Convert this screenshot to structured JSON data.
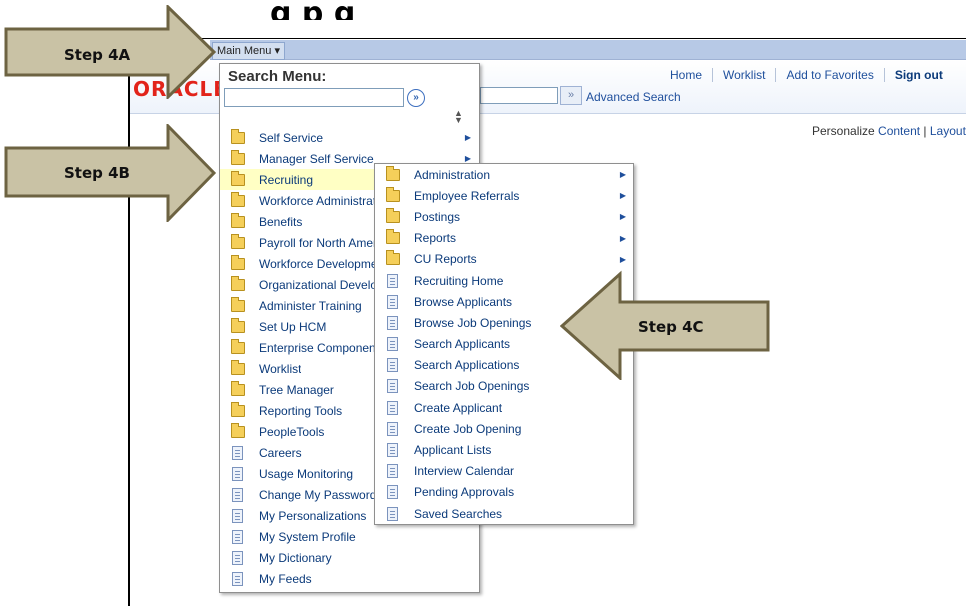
{
  "title_partial": "g                                          p  g",
  "header": {
    "main_menu_label": "Main Menu ▾",
    "logo_text": "ORACLE",
    "nav": [
      "Home",
      "Worklist",
      "Add to Favorites",
      "Sign out"
    ],
    "search_go": "»",
    "advanced_search": "Advanced Search",
    "personalize_prefix": "Personalize ",
    "personalize_content": "Content",
    "personalize_sep": " | ",
    "personalize_layout": "Layout"
  },
  "menu": {
    "search_label": "Search Menu:",
    "search_value": "",
    "search_go": "»",
    "items": [
      {
        "label": "Self Service",
        "type": "folder",
        "arrow": true
      },
      {
        "label": "Manager Self Service",
        "type": "folder",
        "arrow": true
      },
      {
        "label": "Recruiting",
        "type": "folder",
        "arrow": false,
        "highlight": true
      },
      {
        "label": "Workforce Administration",
        "type": "folder",
        "arrow": false
      },
      {
        "label": "Benefits",
        "type": "folder",
        "arrow": false
      },
      {
        "label": "Payroll for North America",
        "type": "folder",
        "arrow": false
      },
      {
        "label": "Workforce Development",
        "type": "folder",
        "arrow": false
      },
      {
        "label": "Organizational Development",
        "type": "folder",
        "arrow": false
      },
      {
        "label": "Administer Training",
        "type": "folder",
        "arrow": false
      },
      {
        "label": "Set Up HCM",
        "type": "folder",
        "arrow": false
      },
      {
        "label": "Enterprise Components",
        "type": "folder",
        "arrow": false
      },
      {
        "label": "Worklist",
        "type": "folder",
        "arrow": false
      },
      {
        "label": "Tree Manager",
        "type": "folder",
        "arrow": false
      },
      {
        "label": "Reporting Tools",
        "type": "folder",
        "arrow": false
      },
      {
        "label": "PeopleTools",
        "type": "folder",
        "arrow": false
      },
      {
        "label": "Careers",
        "type": "doc",
        "arrow": false
      },
      {
        "label": "Usage Monitoring",
        "type": "doc",
        "arrow": false
      },
      {
        "label": "Change My Password",
        "type": "doc",
        "arrow": false
      },
      {
        "label": "My Personalizations",
        "type": "doc",
        "arrow": false
      },
      {
        "label": "My System Profile",
        "type": "doc",
        "arrow": false
      },
      {
        "label": "My Dictionary",
        "type": "doc",
        "arrow": false
      },
      {
        "label": "My Feeds",
        "type": "doc",
        "arrow": false
      }
    ]
  },
  "submenu": {
    "items": [
      {
        "label": "Administration",
        "type": "folder",
        "arrow": true
      },
      {
        "label": "Employee Referrals",
        "type": "folder",
        "arrow": true
      },
      {
        "label": "Postings",
        "type": "folder",
        "arrow": true
      },
      {
        "label": "Reports",
        "type": "folder",
        "arrow": true
      },
      {
        "label": "CU Reports",
        "type": "folder",
        "arrow": true
      },
      {
        "label": "Recruiting Home",
        "type": "doc",
        "arrow": false
      },
      {
        "label": "Browse Applicants",
        "type": "doc",
        "arrow": false
      },
      {
        "label": "Browse Job Openings",
        "type": "doc",
        "arrow": false
      },
      {
        "label": "Search Applicants",
        "type": "doc",
        "arrow": false
      },
      {
        "label": "Search Applications",
        "type": "doc",
        "arrow": false
      },
      {
        "label": "Search Job Openings",
        "type": "doc",
        "arrow": false
      },
      {
        "label": "Create Applicant",
        "type": "doc",
        "arrow": false
      },
      {
        "label": "Create Job Opening",
        "type": "doc",
        "arrow": false
      },
      {
        "label": "Applicant Lists",
        "type": "doc",
        "arrow": false
      },
      {
        "label": "Interview Calendar",
        "type": "doc",
        "arrow": false
      },
      {
        "label": "Pending Approvals",
        "type": "doc",
        "arrow": false
      },
      {
        "label": "Saved Searches",
        "type": "doc",
        "arrow": false
      }
    ]
  },
  "steps": {
    "a": "Step 4A",
    "b": "Step 4B",
    "c": "Step 4C"
  },
  "colors": {
    "arrow_fill": "#c9c2a5",
    "arrow_stroke": "#6d6342",
    "highlight": "#ffffc4",
    "link": "#0b3a7a"
  }
}
